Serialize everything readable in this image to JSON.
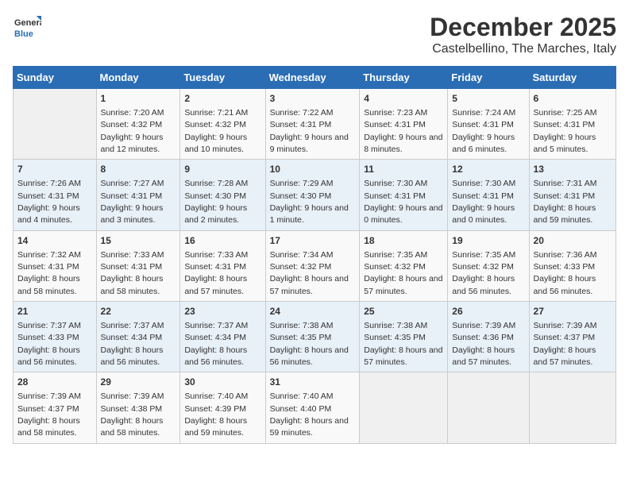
{
  "logo": {
    "general": "General",
    "blue": "Blue"
  },
  "title": "December 2025",
  "subtitle": "Castelbellino, The Marches, Italy",
  "weekdays": [
    "Sunday",
    "Monday",
    "Tuesday",
    "Wednesday",
    "Thursday",
    "Friday",
    "Saturday"
  ],
  "weeks": [
    [
      {
        "day": null
      },
      {
        "day": 1,
        "sunrise": "7:20 AM",
        "sunset": "4:32 PM",
        "daylight": "9 hours and 12 minutes."
      },
      {
        "day": 2,
        "sunrise": "7:21 AM",
        "sunset": "4:32 PM",
        "daylight": "9 hours and 10 minutes."
      },
      {
        "day": 3,
        "sunrise": "7:22 AM",
        "sunset": "4:31 PM",
        "daylight": "9 hours and 9 minutes."
      },
      {
        "day": 4,
        "sunrise": "7:23 AM",
        "sunset": "4:31 PM",
        "daylight": "9 hours and 8 minutes."
      },
      {
        "day": 5,
        "sunrise": "7:24 AM",
        "sunset": "4:31 PM",
        "daylight": "9 hours and 6 minutes."
      },
      {
        "day": 6,
        "sunrise": "7:25 AM",
        "sunset": "4:31 PM",
        "daylight": "9 hours and 5 minutes."
      }
    ],
    [
      {
        "day": 7,
        "sunrise": "7:26 AM",
        "sunset": "4:31 PM",
        "daylight": "9 hours and 4 minutes."
      },
      {
        "day": 8,
        "sunrise": "7:27 AM",
        "sunset": "4:31 PM",
        "daylight": "9 hours and 3 minutes."
      },
      {
        "day": 9,
        "sunrise": "7:28 AM",
        "sunset": "4:30 PM",
        "daylight": "9 hours and 2 minutes."
      },
      {
        "day": 10,
        "sunrise": "7:29 AM",
        "sunset": "4:30 PM",
        "daylight": "9 hours and 1 minute."
      },
      {
        "day": 11,
        "sunrise": "7:30 AM",
        "sunset": "4:31 PM",
        "daylight": "9 hours and 0 minutes."
      },
      {
        "day": 12,
        "sunrise": "7:30 AM",
        "sunset": "4:31 PM",
        "daylight": "9 hours and 0 minutes."
      },
      {
        "day": 13,
        "sunrise": "7:31 AM",
        "sunset": "4:31 PM",
        "daylight": "8 hours and 59 minutes."
      }
    ],
    [
      {
        "day": 14,
        "sunrise": "7:32 AM",
        "sunset": "4:31 PM",
        "daylight": "8 hours and 58 minutes."
      },
      {
        "day": 15,
        "sunrise": "7:33 AM",
        "sunset": "4:31 PM",
        "daylight": "8 hours and 58 minutes."
      },
      {
        "day": 16,
        "sunrise": "7:33 AM",
        "sunset": "4:31 PM",
        "daylight": "8 hours and 57 minutes."
      },
      {
        "day": 17,
        "sunrise": "7:34 AM",
        "sunset": "4:32 PM",
        "daylight": "8 hours and 57 minutes."
      },
      {
        "day": 18,
        "sunrise": "7:35 AM",
        "sunset": "4:32 PM",
        "daylight": "8 hours and 57 minutes."
      },
      {
        "day": 19,
        "sunrise": "7:35 AM",
        "sunset": "4:32 PM",
        "daylight": "8 hours and 56 minutes."
      },
      {
        "day": 20,
        "sunrise": "7:36 AM",
        "sunset": "4:33 PM",
        "daylight": "8 hours and 56 minutes."
      }
    ],
    [
      {
        "day": 21,
        "sunrise": "7:37 AM",
        "sunset": "4:33 PM",
        "daylight": "8 hours and 56 minutes."
      },
      {
        "day": 22,
        "sunrise": "7:37 AM",
        "sunset": "4:34 PM",
        "daylight": "8 hours and 56 minutes."
      },
      {
        "day": 23,
        "sunrise": "7:37 AM",
        "sunset": "4:34 PM",
        "daylight": "8 hours and 56 minutes."
      },
      {
        "day": 24,
        "sunrise": "7:38 AM",
        "sunset": "4:35 PM",
        "daylight": "8 hours and 56 minutes."
      },
      {
        "day": 25,
        "sunrise": "7:38 AM",
        "sunset": "4:35 PM",
        "daylight": "8 hours and 57 minutes."
      },
      {
        "day": 26,
        "sunrise": "7:39 AM",
        "sunset": "4:36 PM",
        "daylight": "8 hours and 57 minutes."
      },
      {
        "day": 27,
        "sunrise": "7:39 AM",
        "sunset": "4:37 PM",
        "daylight": "8 hours and 57 minutes."
      }
    ],
    [
      {
        "day": 28,
        "sunrise": "7:39 AM",
        "sunset": "4:37 PM",
        "daylight": "8 hours and 58 minutes."
      },
      {
        "day": 29,
        "sunrise": "7:39 AM",
        "sunset": "4:38 PM",
        "daylight": "8 hours and 58 minutes."
      },
      {
        "day": 30,
        "sunrise": "7:40 AM",
        "sunset": "4:39 PM",
        "daylight": "8 hours and 59 minutes."
      },
      {
        "day": 31,
        "sunrise": "7:40 AM",
        "sunset": "4:40 PM",
        "daylight": "8 hours and 59 minutes."
      },
      {
        "day": null
      },
      {
        "day": null
      },
      {
        "day": null
      }
    ]
  ]
}
